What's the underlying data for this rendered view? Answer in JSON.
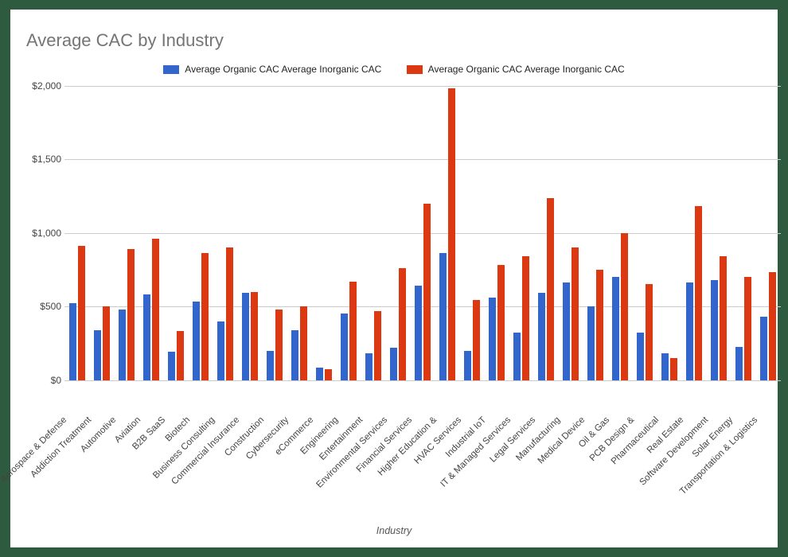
{
  "chart_data": {
    "type": "bar",
    "title": "Average CAC by Industry",
    "xlabel": "Industry",
    "ylabel": "",
    "ylim": [
      0,
      2000
    ],
    "y_ticks": [
      0,
      500,
      1000,
      1500,
      2000
    ],
    "y_tick_labels": [
      "$0",
      "$500",
      "$1,000",
      "$1,500",
      "$2,000"
    ],
    "legend_entries": [
      "Average Organic CAC Average Inorganic CAC",
      "Average Organic CAC Average Inorganic CAC"
    ],
    "colors": {
      "series1": "#3366cc",
      "series2": "#dc3912"
    },
    "categories": [
      "Aerospace & Defense",
      "Addiction Treatment",
      "Automotive",
      "Aviation",
      "B2B SaaS",
      "Biotech",
      "Business Consulting",
      "Commercial Insurance",
      "Construction",
      "Cybersecurity",
      "eCommerce",
      "Engineering",
      "Entertainment",
      "Environmental Services",
      "Financial Services",
      "Higher Education &",
      "HVAC Services",
      "Industrial IoT",
      "IT & Managed Services",
      "Legal Services",
      "Manufacturing",
      "Medical Device",
      "Oil & Gas",
      "PCB Design &",
      "Pharmaceutical",
      "Real Estate",
      "Software Development",
      "Solar Energy",
      "Transportation & Logistics"
    ],
    "series": [
      {
        "name": "Average Organic CAC Average Inorganic CAC",
        "values": [
          520,
          340,
          480,
          580,
          190,
          530,
          400,
          590,
          200,
          340,
          85,
          450,
          180,
          220,
          640,
          860,
          200,
          560,
          320,
          590,
          660,
          500,
          700,
          320,
          180,
          660,
          680,
          225,
          430
        ]
      },
      {
        "name": "Average Organic CAC Average Inorganic CAC",
        "values": [
          910,
          500,
          890,
          960,
          330,
          860,
          900,
          600,
          480,
          500,
          75,
          670,
          470,
          760,
          1200,
          1980,
          545,
          780,
          840,
          1235,
          900,
          750,
          1000,
          650,
          150,
          1180,
          840,
          700,
          730
        ]
      }
    ]
  }
}
